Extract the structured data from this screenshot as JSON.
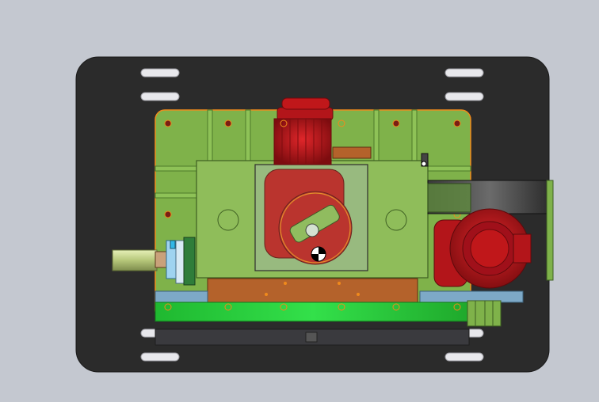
{
  "viewport": {
    "background": "#c4c8d0"
  },
  "model": {
    "base_plate_color": "#2b2b2b",
    "frame_color": "#7fb24a",
    "frame_dark_color": "#5c8a34",
    "gearbox_color": "#8fbd5a",
    "motor_color": "#c0171a",
    "motor_dark_color": "#8d0f12",
    "selection_color": "#f08a1c",
    "bright_green_color": "#27d13a",
    "copper_color": "#b4622b",
    "slot_color": "#e8e8ec",
    "rail_color": "#7da9c7"
  },
  "icons": {
    "center_of_mass": "center-of-mass-icon",
    "triad": "coordinate-triad-icon"
  }
}
